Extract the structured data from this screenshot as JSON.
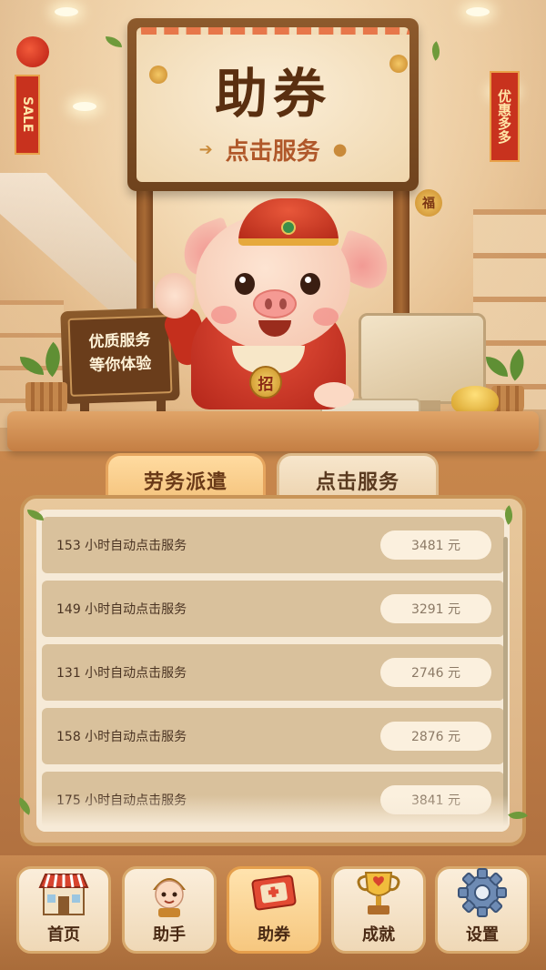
{
  "sign": {
    "title": "助券",
    "subtitle": "点击服务",
    "tag": "福"
  },
  "banners": {
    "left": "SALE",
    "right": "优惠多多"
  },
  "desk_sign": {
    "line1": "优质服务",
    "line2": "等你体验"
  },
  "mascot": {
    "badge": "招"
  },
  "tabs": [
    {
      "label": "劳务派遣",
      "active": true
    },
    {
      "label": "点击服务",
      "active": false
    }
  ],
  "list": [
    {
      "label": "153 小时自动点击服务",
      "price": "3481 元"
    },
    {
      "label": "149 小时自动点击服务",
      "price": "3291 元"
    },
    {
      "label": "131 小时自动点击服务",
      "price": "2746 元"
    },
    {
      "label": "158 小时自动点击服务",
      "price": "2876 元"
    },
    {
      "label": "175 小时自动点击服务",
      "price": "3841 元"
    }
  ],
  "nav": [
    {
      "label": "首页",
      "icon": "shop-icon",
      "active": false
    },
    {
      "label": "助手",
      "icon": "assistant-avatar-icon",
      "active": false
    },
    {
      "label": "助券",
      "icon": "ticket-icon",
      "active": true
    },
    {
      "label": "成就",
      "icon": "trophy-icon",
      "active": false
    },
    {
      "label": "设置",
      "icon": "gear-icon",
      "active": false
    }
  ],
  "colors": {
    "accent": "#c8321e",
    "wood": "#b17140",
    "cream": "#f6ead7"
  }
}
